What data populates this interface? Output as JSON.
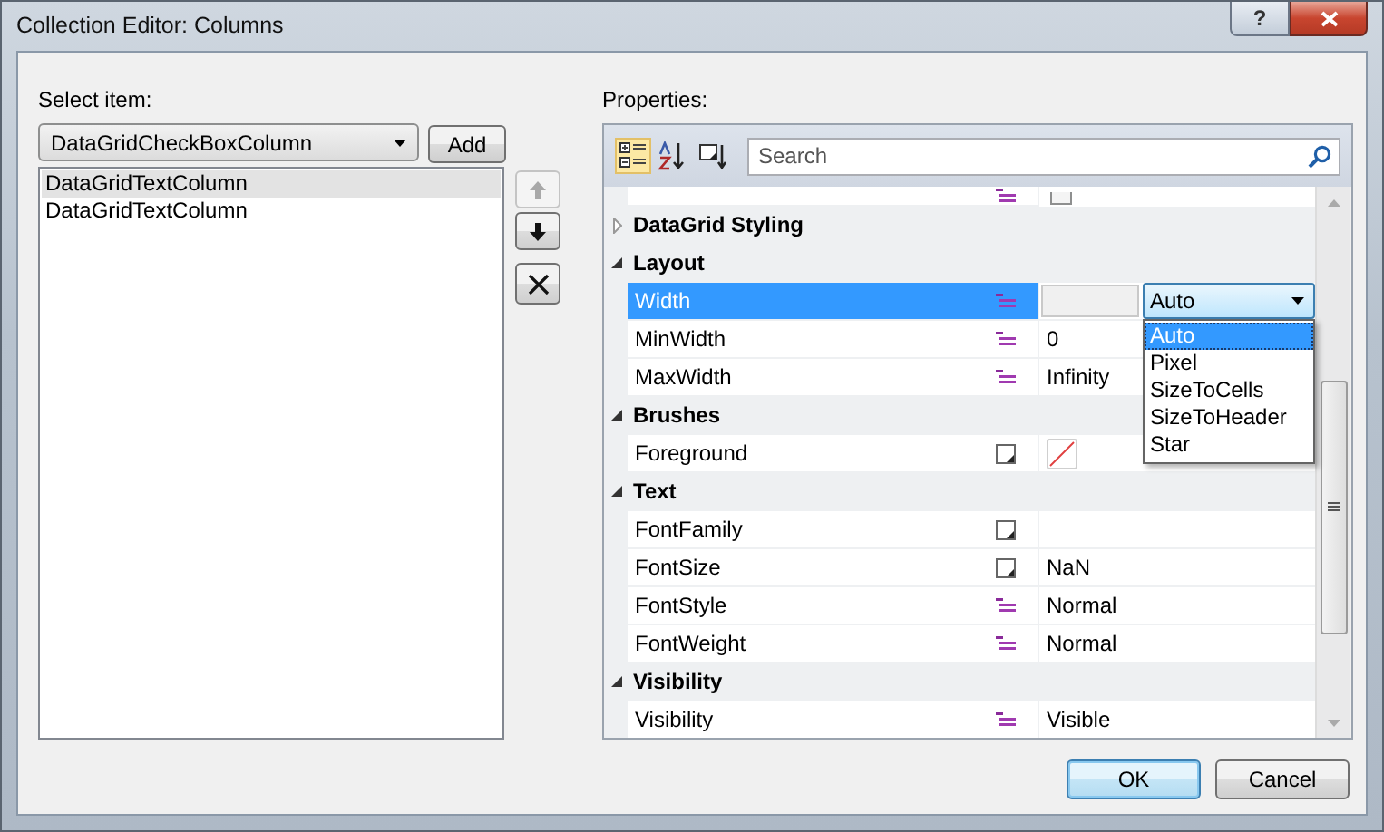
{
  "window": {
    "title": "Collection Editor: Columns",
    "help_button": "?"
  },
  "items_panel": {
    "label": "Select item:",
    "type_combo": {
      "value": "DataGridCheckBoxColumn"
    },
    "add_button": "Add",
    "items": [
      {
        "label": "DataGridTextColumn",
        "selected": true
      },
      {
        "label": "DataGridTextColumn",
        "selected": false
      }
    ],
    "move_buttons": [
      {
        "kind": "up",
        "disabled": true
      },
      {
        "kind": "down",
        "disabled": false
      },
      {
        "kind": "remove",
        "disabled": false
      }
    ]
  },
  "properties_panel": {
    "label": "Properties:",
    "view_buttons": [
      {
        "kind": "categorized",
        "selected": true
      },
      {
        "kind": "alphabetical",
        "selected": false
      },
      {
        "kind": "events",
        "selected": false
      }
    ],
    "search": {
      "placeholder": "Search"
    },
    "rows": [
      {
        "kind": "property",
        "clipped": true,
        "marker": {
          "kind": "list"
        },
        "selected": false,
        "editor": {
          "kind": "checkbox",
          "checked": false
        }
      },
      {
        "kind": "category",
        "name": "DataGrid Styling",
        "expanded": false
      },
      {
        "kind": "category",
        "name": "Layout",
        "expanded": true
      },
      {
        "kind": "property",
        "name": "Width",
        "clipped": false,
        "marker": {
          "kind": "list"
        },
        "selected": true,
        "editor": {
          "kind": "combo",
          "text": "Auto",
          "open": true,
          "options": [
            {
              "label": "Auto",
              "selected": true
            },
            {
              "label": "Pixel",
              "selected": false
            },
            {
              "label": "SizeToCells",
              "selected": false
            },
            {
              "label": "SizeToHeader",
              "selected": false
            },
            {
              "label": "Star",
              "selected": false
            }
          ]
        }
      },
      {
        "kind": "property",
        "name": "MinWidth",
        "clipped": false,
        "marker": {
          "kind": "list"
        },
        "selected": false,
        "editor": {
          "kind": "text",
          "text": "0"
        }
      },
      {
        "kind": "property",
        "name": "MaxWidth",
        "clipped": false,
        "marker": {
          "kind": "list"
        },
        "selected": false,
        "editor": {
          "kind": "text",
          "text": "Infinity"
        }
      },
      {
        "kind": "category",
        "name": "Brushes",
        "expanded": true
      },
      {
        "kind": "property",
        "name": "Foreground",
        "clipped": false,
        "marker": {
          "kind": "box"
        },
        "selected": false,
        "editor": {
          "kind": "brush"
        }
      },
      {
        "kind": "category",
        "name": "Text",
        "expanded": true
      },
      {
        "kind": "property",
        "name": "FontFamily",
        "clipped": false,
        "marker": {
          "kind": "box"
        },
        "selected": false
      },
      {
        "kind": "property",
        "name": "FontSize",
        "clipped": false,
        "marker": {
          "kind": "box"
        },
        "selected": false,
        "editor": {
          "kind": "text",
          "text": "NaN"
        }
      },
      {
        "kind": "property",
        "name": "FontStyle",
        "clipped": false,
        "marker": {
          "kind": "list"
        },
        "selected": false,
        "editor": {
          "kind": "text",
          "text": "Normal"
        }
      },
      {
        "kind": "property",
        "name": "FontWeight",
        "clipped": false,
        "marker": {
          "kind": "list"
        },
        "selected": false,
        "editor": {
          "kind": "text",
          "text": "Normal"
        }
      },
      {
        "kind": "category",
        "name": "Visibility",
        "expanded": true
      },
      {
        "kind": "property",
        "name": "Visibility",
        "clipped": false,
        "marker": {
          "kind": "list"
        },
        "selected": false,
        "editor": {
          "kind": "text",
          "text": "Visible"
        }
      }
    ]
  },
  "buttons": [
    {
      "label": "OK",
      "default": true
    },
    {
      "label": "Cancel",
      "default": false
    }
  ]
}
